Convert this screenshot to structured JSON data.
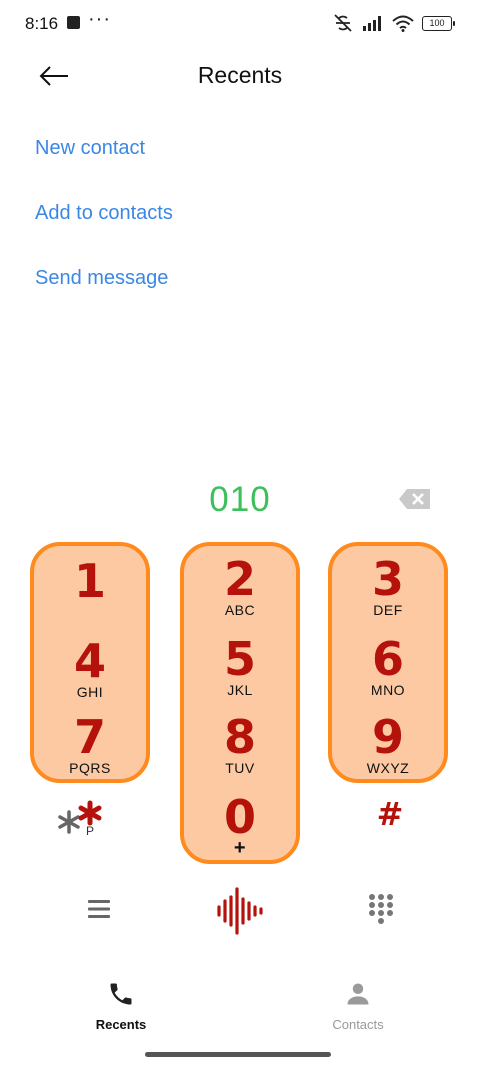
{
  "status_bar": {
    "time": "8:16",
    "dots": "···",
    "battery": "100"
  },
  "header": {
    "title": "Recents"
  },
  "actions": {
    "new_contact": "New contact",
    "add_to_contacts": "Add to contacts",
    "send_message": "Send message"
  },
  "dialer": {
    "number": "010",
    "keys": [
      {
        "digit": "1",
        "letters": ""
      },
      {
        "digit": "2",
        "letters": "ABC"
      },
      {
        "digit": "3",
        "letters": "DEF"
      },
      {
        "digit": "4",
        "letters": "GHI"
      },
      {
        "digit": "5",
        "letters": "JKL"
      },
      {
        "digit": "6",
        "letters": "MNO"
      },
      {
        "digit": "7",
        "letters": "PQRS"
      },
      {
        "digit": "8",
        "letters": "TUV"
      },
      {
        "digit": "9",
        "letters": "WXYZ"
      },
      {
        "digit": "0",
        "letters": "+"
      }
    ],
    "star_sub": "P",
    "hash": "#"
  },
  "bottom_nav": {
    "recents": "Recents",
    "contacts": "Contacts"
  },
  "colors": {
    "accent_link": "#3a87e6",
    "number_green": "#3cc05a",
    "key_fill": "#fcc9a3",
    "key_border": "#ff8a1e",
    "digit_red": "#b5120c"
  }
}
